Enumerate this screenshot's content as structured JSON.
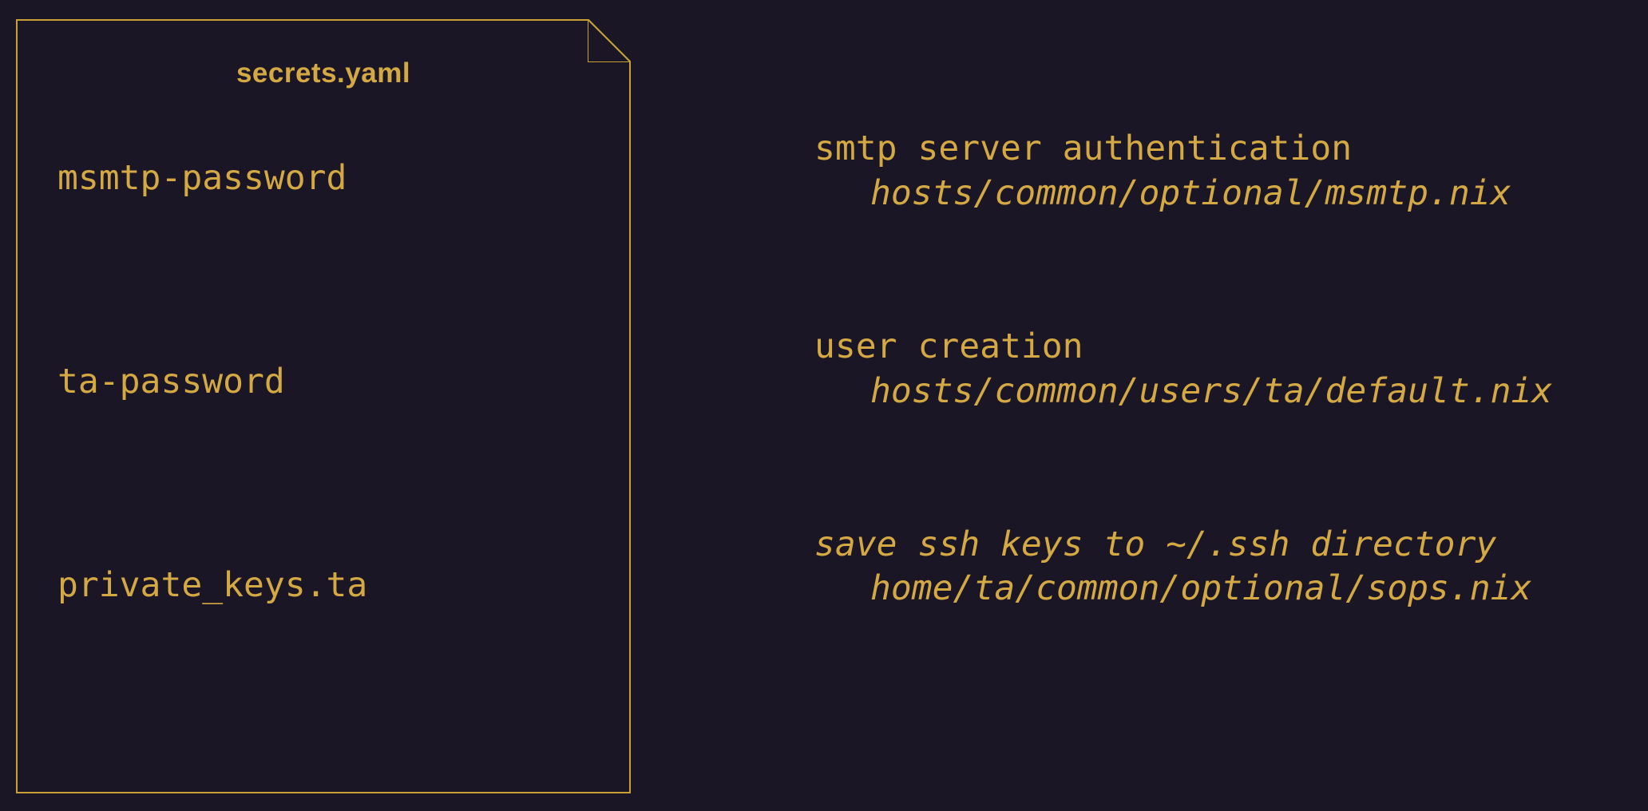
{
  "document": {
    "title": "secrets.yaml",
    "entries": [
      "msmtp-password",
      "ta-password",
      "private_keys.ta"
    ]
  },
  "descriptions": [
    {
      "title": "smtp server authentication",
      "title_italic": false,
      "path": "hosts/common/optional/msmtp.nix"
    },
    {
      "title": "user creation",
      "title_italic": false,
      "path": "hosts/common/users/ta/default.nix"
    },
    {
      "title": "save ssh keys to ~/.ssh directory",
      "title_italic": true,
      "path": "home/ta/common/optional/sops.nix"
    }
  ]
}
